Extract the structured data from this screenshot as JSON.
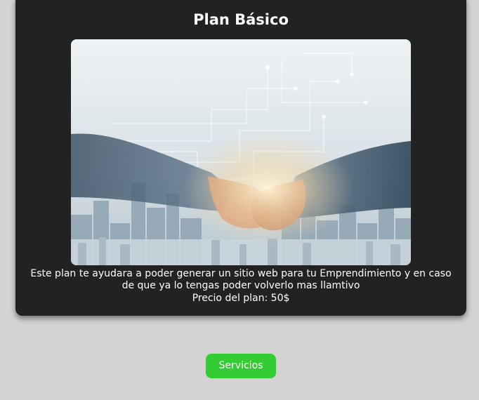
{
  "card": {
    "title": "Plan Básico",
    "image_alt": "handshake-city-image",
    "description": "Este plan te ayudara a poder generar un sitio web para tu Emprendimiento y en caso de que ya lo tengas poder volverlo mas llamtivo",
    "price": "Precio del plan: 50$"
  },
  "actions": {
    "services_label": "Servicios"
  },
  "colors": {
    "page_background": "#d3d3d3",
    "card_background": "#222222",
    "button_background": "#33cc33",
    "text": "#ffffff"
  }
}
